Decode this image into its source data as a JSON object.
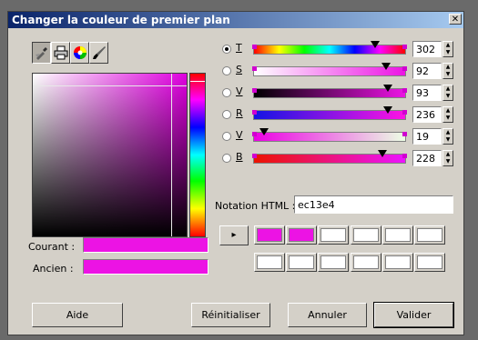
{
  "window": {
    "title": "Changer la couleur de premier plan",
    "close_label": "✕"
  },
  "tabs": [
    {
      "name": "picker-tab",
      "icon": "dropper-icon",
      "active": true
    },
    {
      "name": "scales-tab",
      "icon": "printer-icon",
      "active": false
    },
    {
      "name": "wheel-tab",
      "icon": "color-wheel-icon",
      "active": false
    },
    {
      "name": "brush-tab",
      "icon": "brush-icon",
      "active": false
    }
  ],
  "current_label": "Courant :",
  "previous_label": "Ancien :",
  "current_color": "#ec13e4",
  "previous_color": "#ec13e4",
  "channels": [
    {
      "key": "T",
      "value": "302",
      "selected": true,
      "gradient": "linear-gradient(to right,#ff0000,#ffff00,#00ff00,#00ffff,#0000ff,#ff00ff,#ff0000)",
      "level": 0.84
    },
    {
      "key": "S",
      "value": "92",
      "selected": false,
      "gradient": "linear-gradient(to right,#ffffff,#ec13e4)",
      "level": 0.92
    },
    {
      "key": "V",
      "value": "93",
      "selected": false,
      "gradient": "linear-gradient(to right,#000000,#ec13e4)",
      "level": 0.93
    },
    {
      "key": "R",
      "value": "236",
      "selected": false,
      "gradient": "linear-gradient(to right,#1313e4,#ff13e4)",
      "level": 0.93
    },
    {
      "key": "V",
      "value": "19",
      "selected": false,
      "gradient": "linear-gradient(to right,#ec00e4,#ecffe4)",
      "level": 0.07
    },
    {
      "key": "B",
      "value": "228",
      "selected": false,
      "gradient": "linear-gradient(to right,#ec1300,#ec13ff)",
      "level": 0.89
    }
  ],
  "html_notation": {
    "label": "Notation HTML :",
    "value": "ec13e4"
  },
  "history_arrow": "▸",
  "history_colors": [
    "#ec13e4",
    "#ec13e4",
    "#ffffff",
    "#ffffff",
    "#ffffff",
    "#ffffff",
    "#ffffff",
    "#ffffff",
    "#ffffff",
    "#ffffff",
    "#ffffff",
    "#ffffff"
  ],
  "buttons": {
    "help": "Aide",
    "reset": "Réinitialiser",
    "cancel": "Annuler",
    "validate": "Valider"
  }
}
